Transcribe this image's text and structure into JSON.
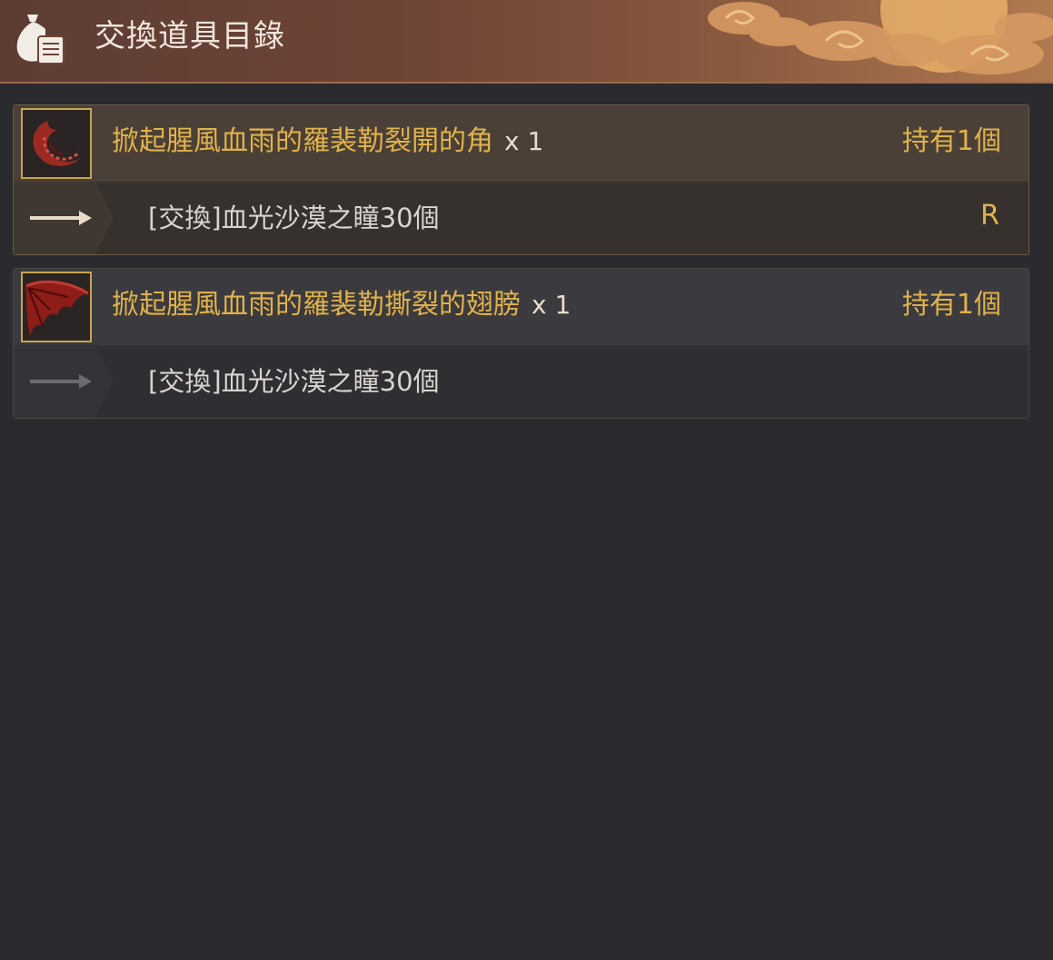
{
  "header": {
    "title": "交換道具目錄",
    "icon": "money-bag-scroll-icon"
  },
  "items": [
    {
      "name": "掀起腥風血雨的羅裴勒裂開的角",
      "quantity": "x 1",
      "held": "持有1個",
      "icon": "curled-horn-icon",
      "reward": "[交換]血光沙漠之瞳30個",
      "rank": "R",
      "active": true
    },
    {
      "name": "掀起腥風血雨的羅裴勒撕裂的翅膀",
      "quantity": "x 1",
      "held": "持有1個",
      "icon": "red-wing-icon",
      "reward": "[交換]血光沙漠之瞳30個",
      "rank": "",
      "active": false
    }
  ],
  "colors": {
    "accent_gold": "#e0b24a",
    "background": "#2b2a2f",
    "header_brown": "#6f4536"
  }
}
